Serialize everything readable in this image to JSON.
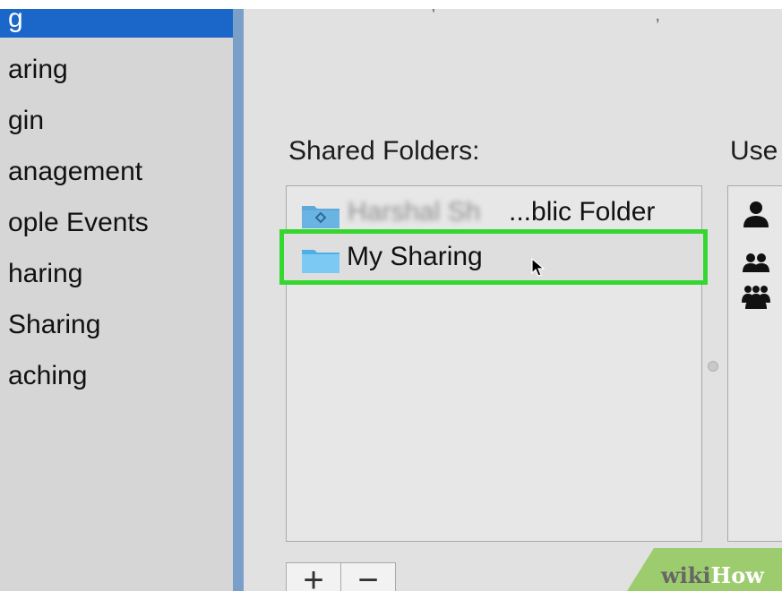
{
  "sidebar": {
    "items": [
      {
        "label": "g",
        "selected": true
      },
      {
        "label": "aring",
        "selected": false
      },
      {
        "label": "gin",
        "selected": false
      },
      {
        "label": "anagement",
        "selected": false
      },
      {
        "label": "ople Events",
        "selected": false
      },
      {
        "label": "haring",
        "selected": false
      },
      {
        "label": "Sharing",
        "selected": false
      },
      {
        "label": "aching",
        "selected": false
      }
    ]
  },
  "shared_folders": {
    "label": "Shared Folders:",
    "items": [
      {
        "label": "...blic Folder",
        "blurred_prefix": "Harshal Sh",
        "icon": "public-folder-icon"
      },
      {
        "label": "My Sharing",
        "icon": "folder-icon",
        "selected": true
      }
    ]
  },
  "users": {
    "label": "Use",
    "icons": [
      "user-icon",
      "group-icon",
      "everyone-icon"
    ]
  },
  "buttons": {
    "add": "+",
    "remove": "−"
  },
  "watermark": {
    "wiki": "wiki",
    "how": "How"
  },
  "colors": {
    "selection": "#1b67c9",
    "highlight": "#35d630",
    "folder": "#6cc2f0"
  }
}
